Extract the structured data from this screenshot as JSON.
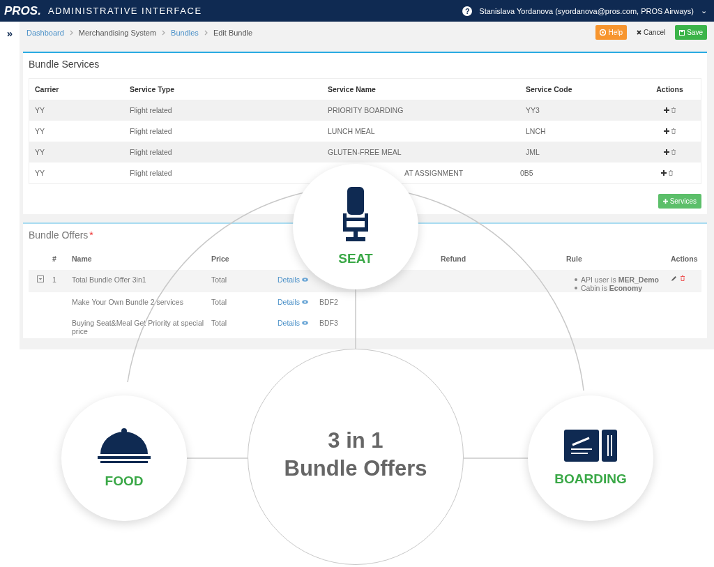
{
  "header": {
    "logo": "PROS.",
    "title": "ADMINISTRATIVE INTERFACE",
    "help_icon": "?",
    "user": "Stanislava Yordanova (syordanova@pros.com, PROS Airways)",
    "caret": "⌄"
  },
  "sidebar_toggle": "»",
  "breadcrumb": [
    {
      "label": "Dashboard",
      "link": true
    },
    {
      "label": "Merchandising System",
      "link": false
    },
    {
      "label": "Bundles",
      "link": true
    },
    {
      "label": "Edit Bundle",
      "link": false
    }
  ],
  "actions": [
    {
      "kind": "help",
      "label": "Help"
    },
    {
      "kind": "cancel",
      "label": "Cancel"
    },
    {
      "kind": "save",
      "label": "Save"
    }
  ],
  "bundle_services": {
    "title": "Bundle Services",
    "columns": [
      "Carrier",
      "Service Type",
      "Service Name",
      "Service Code",
      "Actions"
    ],
    "rows": [
      {
        "carrier": "YY",
        "type": "Flight related",
        "name": "PRIORITY BOARDING",
        "code": "YY3"
      },
      {
        "carrier": "YY",
        "type": "Flight related",
        "name": "LUNCH MEAL",
        "code": "LNCH"
      },
      {
        "carrier": "YY",
        "type": "Flight related",
        "name": "GLUTEN-FREE MEAL",
        "code": "JML"
      },
      {
        "carrier": "YY",
        "type": "Flight related",
        "name": "AT ASSIGNMENT",
        "code": "0B5"
      }
    ],
    "add_button": "Services"
  },
  "bundle_offers": {
    "title": "Bundle Offers",
    "required": "*",
    "columns": [
      "#",
      "Name",
      "Price",
      "Refund",
      "Rule",
      "Actions"
    ],
    "rows": [
      {
        "expandable": true,
        "number": "1",
        "name": "Total Bundle Offer 3in1",
        "price": "Total",
        "details": "Details",
        "code": "",
        "rules": [
          "API user is **MER_Demo**",
          "Cabin is **Economy**"
        ]
      },
      {
        "expandable": false,
        "number": "",
        "name": "Make Your Own Bundle 2 services",
        "price": "Total",
        "details": "Details",
        "code": "BDF2",
        "rules": []
      },
      {
        "expandable": false,
        "number": "",
        "name": "Buying Seat&Meal Get Priority at special price",
        "price": "Total",
        "details": "Details",
        "code": "BDF3",
        "rules": []
      }
    ]
  },
  "diagram": {
    "center": [
      "3 in 1",
      "Bundle Offers"
    ],
    "nodes": [
      {
        "kind": "seat",
        "label": "SEAT"
      },
      {
        "kind": "food",
        "label": "FOOD"
      },
      {
        "kind": "boarding",
        "label": "BOARDING"
      }
    ]
  }
}
